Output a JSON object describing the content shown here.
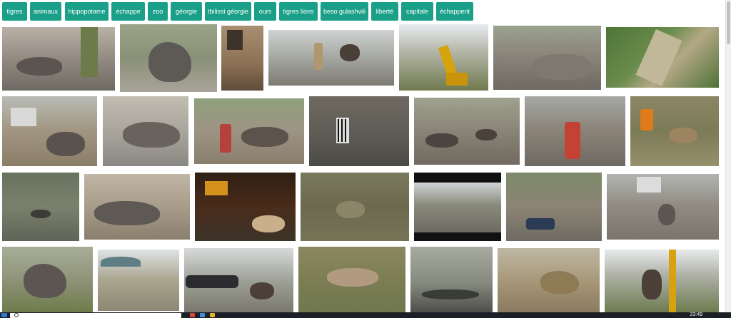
{
  "tags": [
    "tigres",
    "animaux",
    "hippopotame",
    "échappe",
    "zoo",
    "géorgie",
    "tbilissi géorgie",
    "ours",
    "tigres lions",
    "beso gulashvili",
    "liberté",
    "capitale",
    "échappent"
  ],
  "thumbnails": [
    {
      "label": "Hippopotame dans une rue inondée",
      "icon": "hippo-street-photo"
    },
    {
      "label": "Hippopotame sous un arbre",
      "icon": "hippo-tree-photo"
    },
    {
      "label": "Bâtiment en ruine",
      "icon": "ruined-building-photo"
    },
    {
      "label": "Homme et ours dans la boue",
      "icon": "bear-flood-photo"
    },
    {
      "label": "Pelleteuse soulevant un animal",
      "icon": "excavator-photo"
    },
    {
      "label": "Secouristes dans les décombres",
      "icon": "rescuers-debris-photo"
    },
    {
      "label": "Vue aérienne de la vallée inondée",
      "icon": "aerial-flood-photo"
    },
    {
      "label": "Foule tirant un hippopotame",
      "icon": "crowd-hippo-photo"
    },
    {
      "label": "Hippopotame guidé par des hommes",
      "icon": "hippo-men-photo"
    },
    {
      "label": "Hommes poussant un hippopotame",
      "icon": "pushing-hippo-photo"
    },
    {
      "label": "Animaux morts dans la boue",
      "icon": "dead-animals-photo"
    },
    {
      "label": "Animaux couchés dans la boue",
      "icon": "mud-animals-photo"
    },
    {
      "label": "Homme portant un animal",
      "icon": "man-carrying-photo"
    },
    {
      "label": "Secouriste près d'un animal",
      "icon": "rescuer-animal-photo"
    },
    {
      "label": "Animal dans l'eau",
      "icon": "water-animal-photo"
    },
    {
      "label": "Hippopotame près d'une clôture",
      "icon": "hippo-fence-photo"
    },
    {
      "label": "Tigre dans la nuit",
      "icon": "tiger-night-photo"
    },
    {
      "label": "Animal dans la boue",
      "icon": "mud-animal-photo"
    },
    {
      "label": "Route détruite",
      "icon": "destroyed-road-photo"
    },
    {
      "label": "Voiture dans les débris",
      "icon": "car-debris-photo"
    },
    {
      "label": "Hippopotame entouré de gens",
      "icon": "hippo-crowd-photo"
    },
    {
      "label": "Hippopotame dans la végétation",
      "icon": "hippo-plants-photo"
    },
    {
      "label": "Rue avec parasols",
      "icon": "umbrella-street-photo"
    },
    {
      "label": "Ours près d'une voiture",
      "icon": "bear-car-photo"
    },
    {
      "label": "Lion mort sur le sol",
      "icon": "dead-lion-photo"
    },
    {
      "label": "Crocodile dans l'eau",
      "icon": "crocodile-photo"
    },
    {
      "label": "Hippopotame dans l'eau",
      "icon": "hippo-water-photo"
    },
    {
      "label": "Grue soulevant un animal",
      "icon": "crane-animal-photo"
    }
  ],
  "colors": {
    "tag_bg": "#1aa089",
    "tag_text": "#ffffff",
    "taskbar": "#1c1f26"
  },
  "taskbar": {
    "clock": "23:49"
  }
}
